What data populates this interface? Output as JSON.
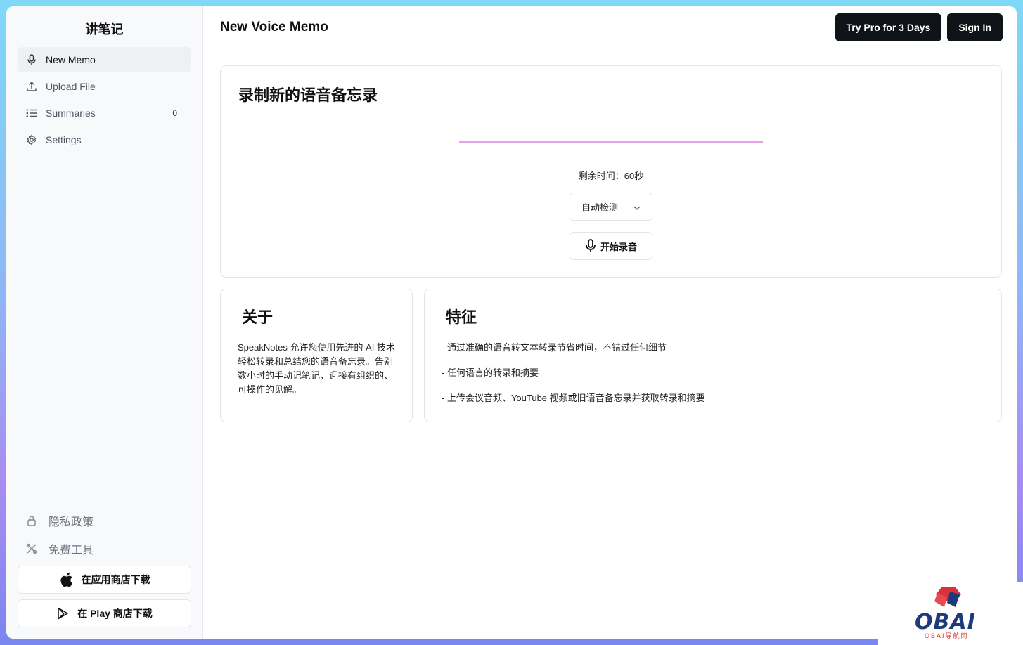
{
  "sidebar": {
    "app_title": "讲笔记",
    "items": [
      {
        "label": "New Memo",
        "icon": "microphone-icon",
        "active": true
      },
      {
        "label": "Upload File",
        "icon": "upload-icon"
      },
      {
        "label": "Summaries",
        "icon": "list-icon",
        "count": "0"
      },
      {
        "label": "Settings",
        "icon": "gear-icon"
      }
    ],
    "privacy": "隐私政策",
    "free_tools": "免费工具",
    "app_store": "在应用商店下载",
    "play_store": "在 Play 商店下载"
  },
  "header": {
    "title": "New Voice Memo",
    "try_pro": "Try Pro for 3 Days",
    "sign_in": "Sign In"
  },
  "recorder": {
    "title": "录制新的语音备忘录",
    "remaining": "剩余时间：60秒",
    "language_selected": "自动检测",
    "start_button": "开始录音"
  },
  "about": {
    "title": "关于",
    "text": "SpeakNotes 允许您使用先进的 AI 技术轻松转录和总结您的语音备忘录。告别数小时的手动记笔记，迎接有组织的、可操作的见解。"
  },
  "features": {
    "title": "特征",
    "items": [
      "- 通过准确的语音转文本转录节省时间，不错过任何细节",
      "- 任何语言的转录和摘要",
      "- 上传会议音频、YouTube 视频或旧语音备忘录并获取转录和摘要"
    ]
  },
  "watermark": {
    "brand": "OBAI",
    "sub": "OBAI导航网"
  },
  "colors": {
    "primary_button": "#101418",
    "waveform": "#e6a0ea",
    "sidebar_bg": "#f8f9fb"
  }
}
